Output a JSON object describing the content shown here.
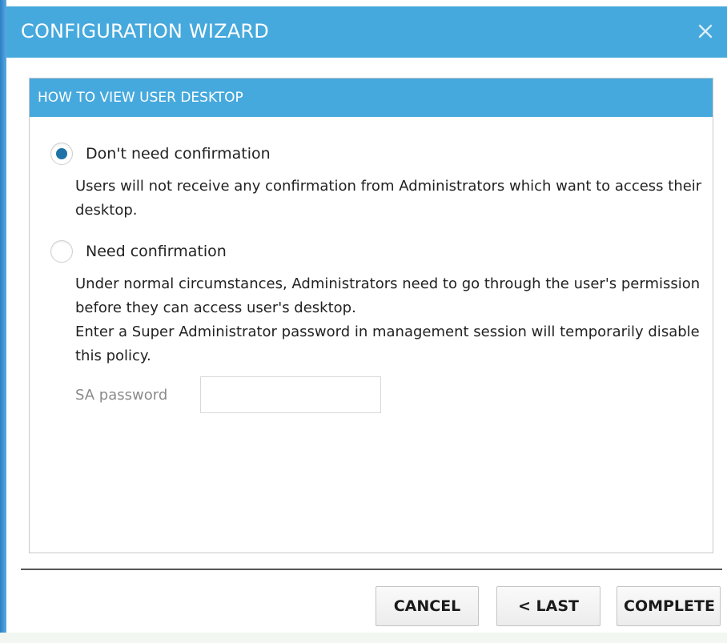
{
  "window": {
    "title": "CONFIGURATION WIZARD"
  },
  "panel": {
    "title": "HOW TO VIEW USER DESKTOP",
    "options": [
      {
        "label": "Don't need confirmation",
        "selected": true,
        "description": [
          "Users will not receive any confirmation from Administrators which want to access their desktop."
        ]
      },
      {
        "label": "Need confirmation",
        "selected": false,
        "description": [
          "Under normal circumstances, Administrators need to go through the user's permission before they can access user's desktop.",
          "Enter a Super Administrator password in management session will temporarily disable this policy."
        ]
      }
    ],
    "sa_password": {
      "label": "SA password",
      "value": ""
    }
  },
  "footer": {
    "cancel_label": "CANCEL",
    "last_label": "< LAST",
    "complete_label": "COMPLETE"
  },
  "colors": {
    "accent": "#46a9dd",
    "radio_selected": "#1f72a8"
  },
  "icons": {
    "close": "close-icon"
  }
}
